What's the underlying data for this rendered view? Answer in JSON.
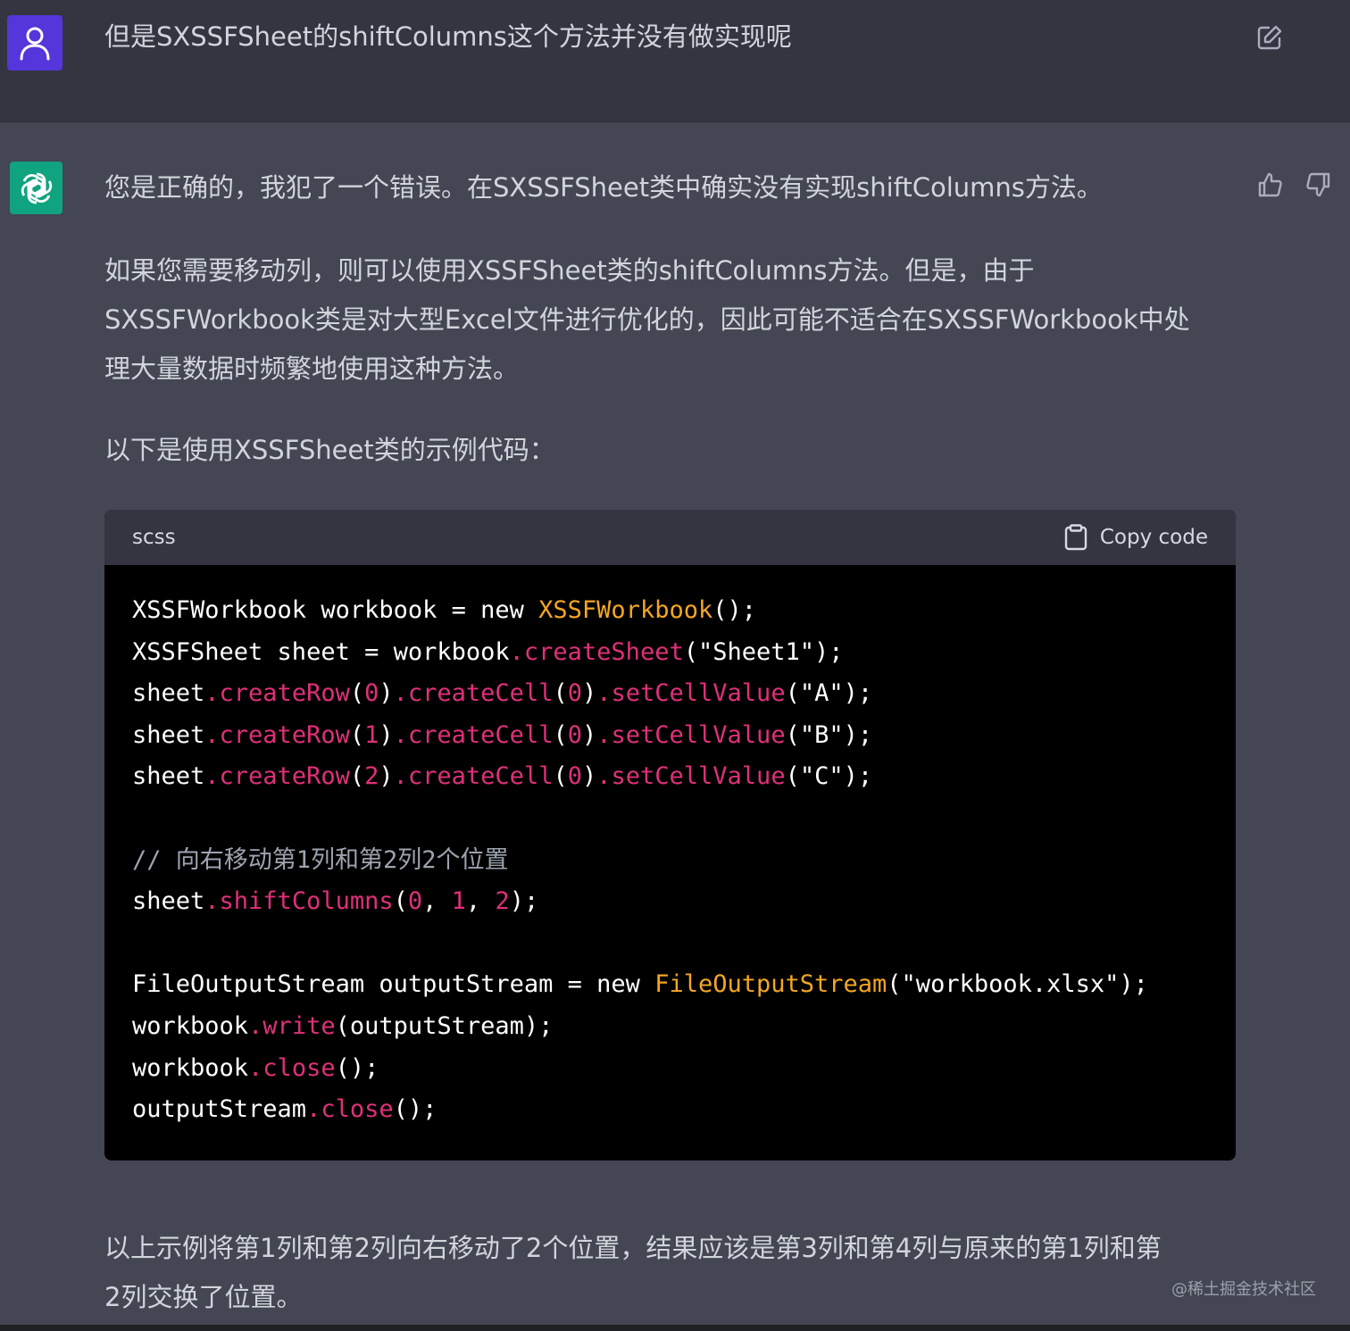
{
  "user_message": {
    "text": "但是SXSSFSheet的shiftColumns这个方法并没有做实现呢",
    "avatar_icon": "user-icon",
    "edit_icon": "edit-icon"
  },
  "assistant_message": {
    "avatar_icon": "openai-logo-icon",
    "paragraphs": [
      "您是正确的，我犯了一个错误。在SXSSFSheet类中确实没有实现shiftColumns方法。",
      "如果您需要移动列，则可以使用XSSFSheet类的shiftColumns方法。但是，由于",
      "SXSSFWorkbook类是对大型Excel文件进行优化的，因此可能不适合在SXSSFWorkbook中处",
      "理大量数据时频繁地使用这种方法。",
      "以下是使用XSSFSheet类的示例代码：",
      "以上示例将第1列和第2列向右移动了2个位置，结果应该是第3列和第4列与原来的第1列和第",
      "2列交换了位置。"
    ],
    "thumbs_up_icon": "thumbs-up-icon",
    "thumbs_down_icon": "thumbs-down-icon"
  },
  "code_block": {
    "language": "scss",
    "copy_label": "Copy code",
    "copy_icon": "clipboard-icon",
    "lines": [
      [
        [
          "XSSFWorkbook workbook = new ",
          "plain"
        ],
        [
          "XSSFWorkbook",
          "class"
        ],
        [
          "();",
          "plain"
        ]
      ],
      [
        [
          "XSSFSheet sheet = workbook",
          "plain"
        ],
        [
          ".createSheet",
          "method"
        ],
        [
          "(\"Sheet1\");",
          "plain"
        ]
      ],
      [
        [
          "sheet",
          "plain"
        ],
        [
          ".createRow",
          "method"
        ],
        [
          "(",
          "plain"
        ],
        [
          "0",
          "num"
        ],
        [
          ")",
          "plain"
        ],
        [
          ".createCell",
          "method"
        ],
        [
          "(",
          "plain"
        ],
        [
          "0",
          "num"
        ],
        [
          ")",
          "plain"
        ],
        [
          ".setCellValue",
          "method"
        ],
        [
          "(\"A\");",
          "plain"
        ]
      ],
      [
        [
          "sheet",
          "plain"
        ],
        [
          ".createRow",
          "method"
        ],
        [
          "(",
          "plain"
        ],
        [
          "1",
          "num"
        ],
        [
          ")",
          "plain"
        ],
        [
          ".createCell",
          "method"
        ],
        [
          "(",
          "plain"
        ],
        [
          "0",
          "num"
        ],
        [
          ")",
          "plain"
        ],
        [
          ".setCellValue",
          "method"
        ],
        [
          "(\"B\");",
          "plain"
        ]
      ],
      [
        [
          "sheet",
          "plain"
        ],
        [
          ".createRow",
          "method"
        ],
        [
          "(",
          "plain"
        ],
        [
          "2",
          "num"
        ],
        [
          ")",
          "plain"
        ],
        [
          ".createCell",
          "method"
        ],
        [
          "(",
          "plain"
        ],
        [
          "0",
          "num"
        ],
        [
          ")",
          "plain"
        ],
        [
          ".setCellValue",
          "method"
        ],
        [
          "(\"C\");",
          "plain"
        ]
      ],
      [],
      [
        [
          "// 向右移动第1列和第2列2个位置",
          "comment"
        ]
      ],
      [
        [
          "sheet",
          "plain"
        ],
        [
          ".shiftColumns",
          "method"
        ],
        [
          "(",
          "plain"
        ],
        [
          "0",
          "num"
        ],
        [
          ", ",
          "plain"
        ],
        [
          "1",
          "num"
        ],
        [
          ", ",
          "plain"
        ],
        [
          "2",
          "num"
        ],
        [
          ");",
          "plain"
        ]
      ],
      [],
      [
        [
          "FileOutputStream outputStream = new ",
          "plain"
        ],
        [
          "FileOutputStream",
          "class"
        ],
        [
          "(\"workbook.xlsx\");",
          "plain"
        ]
      ],
      [
        [
          "workbook",
          "plain"
        ],
        [
          ".write",
          "method"
        ],
        [
          "(outputStream);",
          "plain"
        ]
      ],
      [
        [
          "workbook",
          "plain"
        ],
        [
          ".close",
          "method"
        ],
        [
          "();",
          "plain"
        ]
      ],
      [
        [
          "outputStream",
          "plain"
        ],
        [
          ".close",
          "method"
        ],
        [
          "();",
          "plain"
        ]
      ]
    ]
  },
  "watermark": "@稀土掘金技术社区",
  "colors": {
    "user_bg": "#343541",
    "assistant_bg": "#444654",
    "user_avatar": "#5436da",
    "bot_avatar": "#10a37f",
    "code_class": "#f5a623",
    "code_method": "#df3079"
  }
}
